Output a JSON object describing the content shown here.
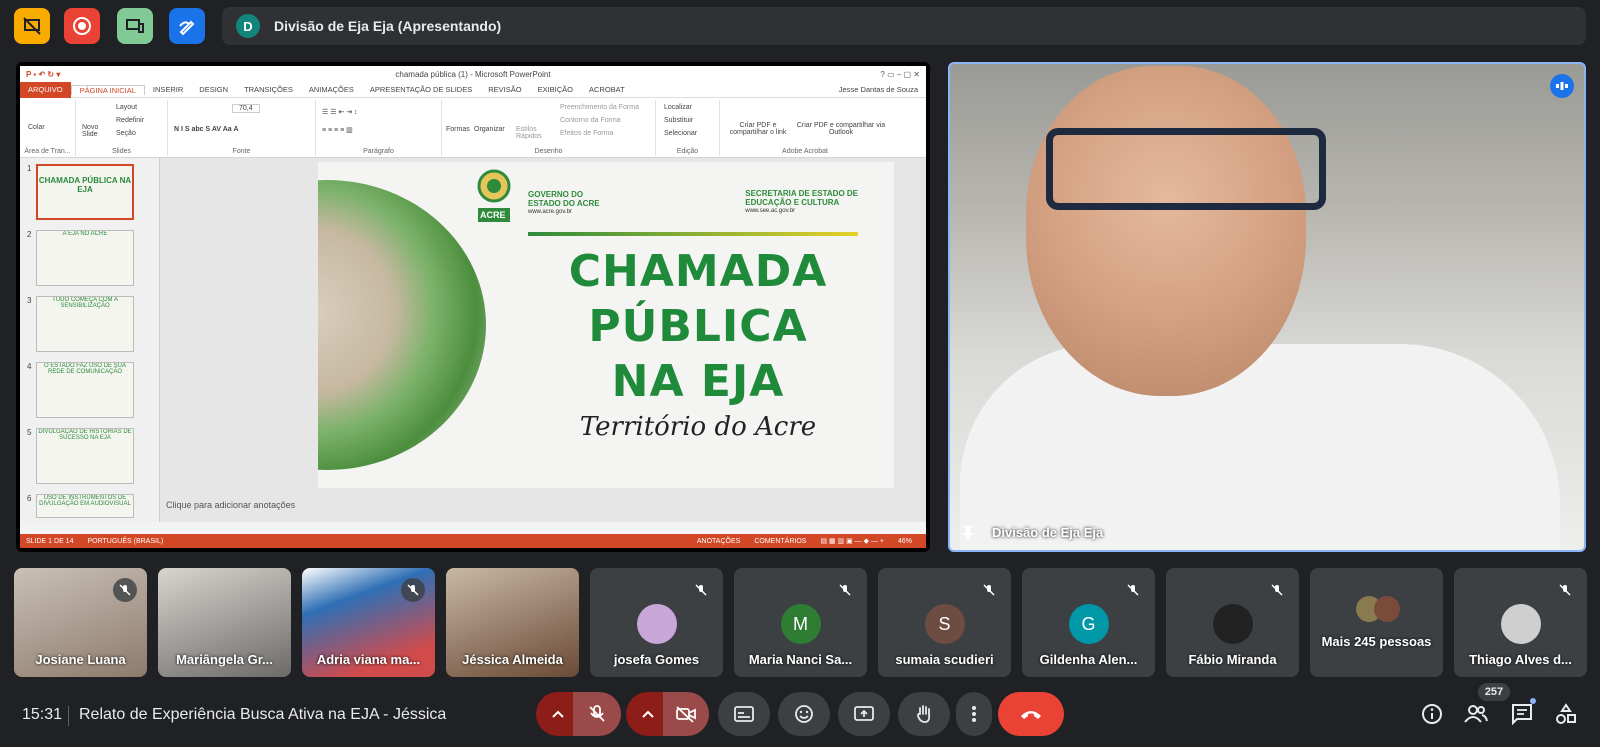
{
  "meeting": {
    "presenter_initial": "D",
    "presenter_label": "Divisão de Eja Eja (Apresentando)",
    "time": "15:31",
    "name": "Relato de Experiência Busca Ativa na EJA - Jéssica",
    "participant_count": "257"
  },
  "ppt": {
    "title": "chamada pública (1) - Microsoft PowerPoint",
    "user": "Jesse Dantas de Souza",
    "tabs": [
      "ARQUIVO",
      "PÁGINA INICIAL",
      "INSERIR",
      "DESIGN",
      "TRANSIÇÕES",
      "ANIMAÇÕES",
      "APRESENTAÇÃO DE SLIDES",
      "REVISÃO",
      "EXIBIÇÃO",
      "ACROBAT"
    ],
    "ribbon": {
      "colar": "Colar",
      "area": "Área de Tran...",
      "novo": "Novo Slide",
      "layout": "Layout",
      "redefinir": "Redefinir",
      "secao": "Seção",
      "slides": "Slides",
      "fonte": "Fonte",
      "font_size": "70,4",
      "paragrafo": "Parágrafo",
      "formas": "Formas",
      "organizar": "Organizar",
      "estilos": "Estilos Rápidos",
      "preench": "Preenchimento da Forma",
      "contorno": "Contorno da Forma",
      "efeitos": "Efeitos de Forma",
      "desenho": "Desenho",
      "localizar": "Localizar",
      "substituir": "Substituir",
      "selecionar": "Selecionar",
      "edicao": "Edição",
      "pdf_link": "Criar PDF e compartilhar o link",
      "pdf_outlook": "Criar PDF e compartilhar via Outlook",
      "acrobat": "Adobe Acrobat"
    },
    "thumbs": [
      {
        "num": "1",
        "text": "CHAMADA PÚBLICA NA EJA"
      },
      {
        "num": "2",
        "text": "A EJA NO ACRE"
      },
      {
        "num": "3",
        "text": "TUDO COMEÇA COM A SENSIBILIZAÇÃO"
      },
      {
        "num": "4",
        "text": "O ESTADO FAZ USO DE SUA REDE DE COMUNICAÇÃO"
      },
      {
        "num": "5",
        "text": "DIVULGAÇÃO DE HISTÓRIAS DE SUCESSO NA EJA"
      },
      {
        "num": "6",
        "text": "USO DE INSTRUMENTOS DE DIVULGAÇÃO EM AUDIOVISUAL"
      }
    ],
    "slide": {
      "gov1": "GOVERNO DO",
      "gov2": "ESTADO DO ACRE",
      "gov_url": "www.acre.gov.br",
      "sec1": "SECRETARIA DE ESTADO DE",
      "sec2": "EDUCAÇÃO E CULTURA",
      "sec_url": "www.see.ac.gov.br",
      "logo_text": "ACRE",
      "line1": "CHAMADA",
      "line2": "PÚBLICA",
      "line3": "NA EJA",
      "subtitle": "Território do Acre"
    },
    "notes": "Clique para adicionar anotações",
    "status": {
      "slide": "SLIDE 1 DE 14",
      "lang": "PORTUGUÊS (BRASIL)",
      "anot": "ANOTAÇÕES",
      "coment": "COMENTÁRIOS",
      "zoom": "46%"
    }
  },
  "camera": {
    "name": "Divisão de Eja Eja"
  },
  "participants": [
    {
      "name": "Josiane Luana",
      "initial": "",
      "color": ""
    },
    {
      "name": "Mariângela Gr...",
      "initial": "",
      "color": ""
    },
    {
      "name": "Adria viana ma...",
      "initial": "",
      "color": ""
    },
    {
      "name": "Jéssica Almeida",
      "initial": "",
      "color": ""
    },
    {
      "name": "josefa Gomes",
      "initial": "",
      "color": "#c9a7d8"
    },
    {
      "name": "Maria Nanci Sa...",
      "initial": "M",
      "color": "#2e7d32"
    },
    {
      "name": "sumaia scudieri",
      "initial": "S",
      "color": "#6d4c41"
    },
    {
      "name": "Gildenha Alen...",
      "initial": "G",
      "color": "#0097a7"
    },
    {
      "name": "Fábio Miranda",
      "initial": "",
      "color": "#222222"
    },
    {
      "name": "Mais 245 pessoas",
      "initial": "",
      "color": ""
    },
    {
      "name": "Thiago Alves d...",
      "initial": "",
      "color": "#cfcfcf"
    }
  ],
  "colors": {
    "end_call": "#ea4335",
    "mic_off": "#9b4a4a",
    "accent": "#8ab4f8",
    "ppt": "#d24726",
    "eja_green": "#1f8a3a"
  }
}
